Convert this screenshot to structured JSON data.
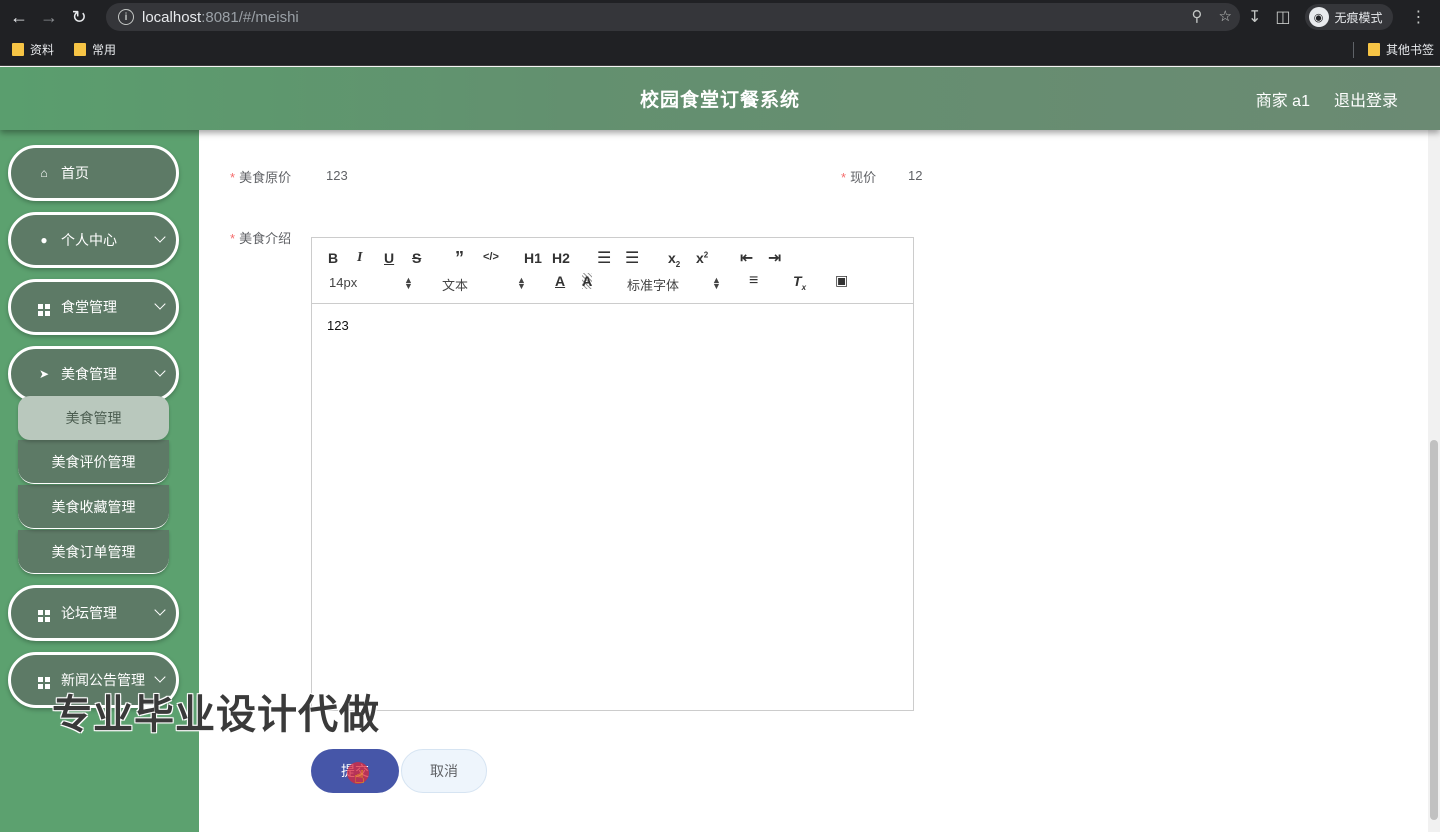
{
  "browser": {
    "url_host": "localhost",
    "url_rest": ":8081/#/meishi",
    "incognito_label": "无痕模式",
    "bookmarks": [
      "资料",
      "常用"
    ],
    "other_bookmarks": "其他书签"
  },
  "header": {
    "title": "校园食堂订餐系统",
    "user": "商家 a1",
    "logout": "退出登录"
  },
  "sidebar": {
    "items": [
      {
        "label": "首页",
        "icon": "home-icon"
      },
      {
        "label": "个人中心",
        "icon": "user-icon"
      },
      {
        "label": "食堂管理",
        "icon": "grid-icon"
      },
      {
        "label": "美食管理",
        "icon": "send-icon"
      },
      {
        "label": "论坛管理",
        "icon": "grid-icon"
      },
      {
        "label": "新闻公告管理",
        "icon": "grid-icon"
      }
    ],
    "sub_items": [
      "美食管理",
      "美食评价管理",
      "美食收藏管理",
      "美食订单管理"
    ]
  },
  "form": {
    "original_price_label": "美食原价",
    "original_price_value": "123",
    "current_price_label": "现价",
    "current_price_value": "12",
    "intro_label": "美食介绍",
    "required_mark": "*"
  },
  "editor": {
    "font_size": "14px",
    "paragraph": "文本",
    "font_family": "标准字体",
    "content": "123",
    "h1": "H1",
    "h2": "H2"
  },
  "buttons": {
    "submit": "提交",
    "cancel": "取消"
  },
  "watermark": "专业毕业设计代做"
}
